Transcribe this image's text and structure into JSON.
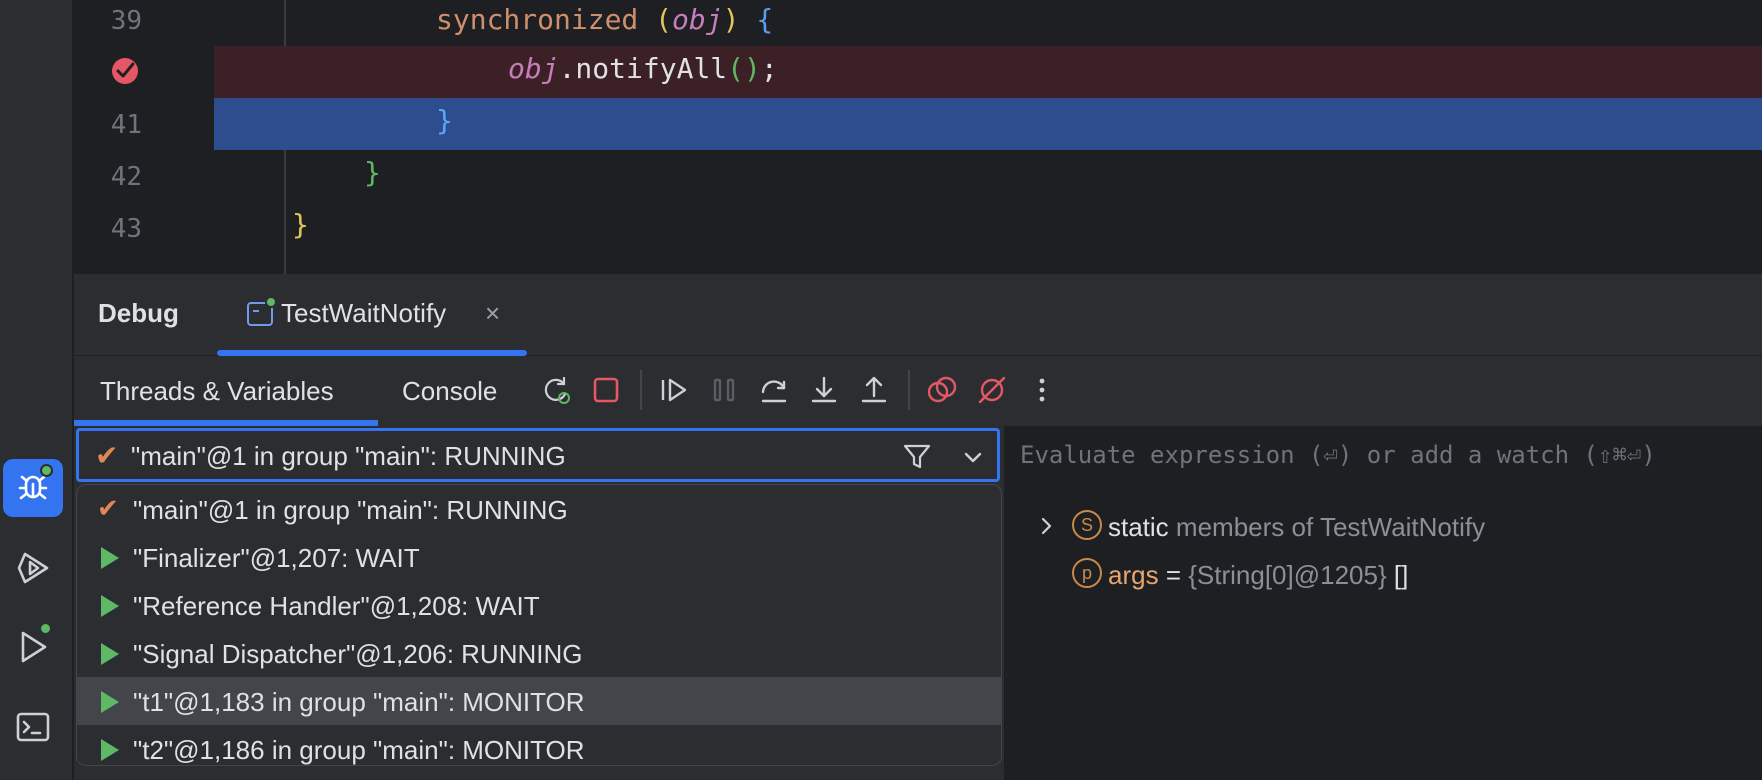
{
  "editor": {
    "lines": [
      {
        "num": "39",
        "text": "synchronized (obj) {"
      },
      {
        "num": "",
        "text": "obj.notifyAll();"
      },
      {
        "num": "41",
        "text": "}"
      },
      {
        "num": "42",
        "text": "}"
      },
      {
        "num": "43",
        "text": "}"
      }
    ],
    "tokens": {
      "l39_kw": "synchronized",
      "l39_open": "(",
      "l39_obj": "obj",
      "l39_close": ")",
      "l39_brace": "{",
      "l40_obj": "obj",
      "l40_call": ".notifyAll",
      "l40_parens": "()",
      "l40_semi": ";",
      "l41_brace": "}",
      "l42_brace": "}",
      "l43_brace": "}"
    }
  },
  "debug": {
    "title": "Debug",
    "tab_label": "TestWaitNotify",
    "tab_close": "×"
  },
  "subtabs": {
    "threads": "Threads & Variables",
    "console": "Console"
  },
  "thread_combo": {
    "selected": "\"main\"@1 in group \"main\": RUNNING"
  },
  "threads": [
    {
      "label": "\"main\"@1 in group \"main\": RUNNING",
      "icon": "check"
    },
    {
      "label": "\"Finalizer\"@1,207: WAIT",
      "icon": "play"
    },
    {
      "label": "\"Reference Handler\"@1,208: WAIT",
      "icon": "play"
    },
    {
      "label": "\"Signal Dispatcher\"@1,206: RUNNING",
      "icon": "play"
    },
    {
      "label": "\"t1\"@1,183 in group \"main\": MONITOR",
      "icon": "play"
    },
    {
      "label": "\"t2\"@1,186 in group \"main\": MONITOR",
      "icon": "play"
    }
  ],
  "variables": {
    "eval_placeholder": "Evaluate expression (⏎) or add a watch (⇧⌘⏎)",
    "static_badge": "S",
    "static_key": "static",
    "static_rest": "members of TestWaitNotify",
    "args_badge": "p",
    "args_name": "args",
    "args_eq": "=",
    "args_type": "{String[0]@1205}",
    "args_val": "[]"
  },
  "colors": {
    "accent": "#3574f0",
    "breakpoint": "#e55765",
    "running_green": "#5fb865",
    "check_orange": "#e08855"
  }
}
